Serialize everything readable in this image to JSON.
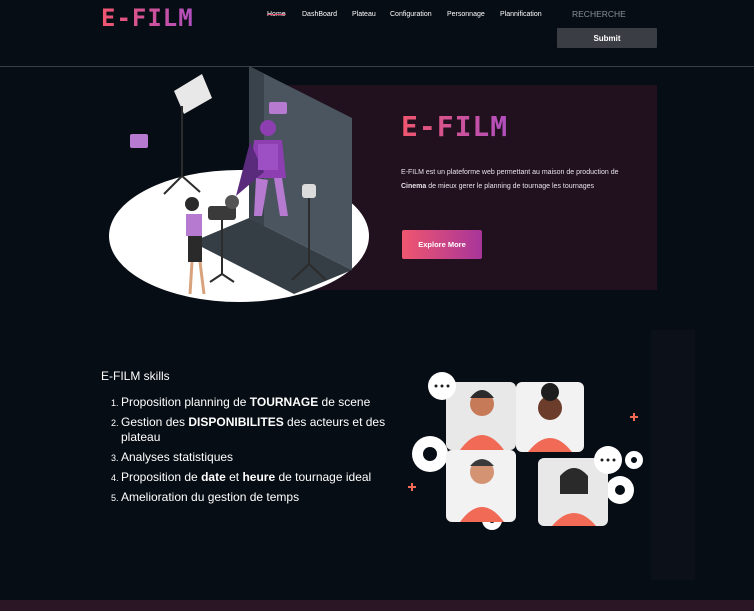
{
  "header": {
    "logo": "E-FILM",
    "nav": [
      "Home",
      "DashBoard",
      "Plateau",
      "Configuration",
      "Personnage",
      "Plannification"
    ],
    "search_placeholder": "RECHERCHE",
    "submit_label": "Submit"
  },
  "hero": {
    "title": "E-FILM",
    "description_parts": [
      "E-FILM est un plateforme web permettant au maison de production de ",
      "Cinema",
      " de mieux gerer le planning de tournage les tournages"
    ],
    "cta_label": "Explore More"
  },
  "skills": {
    "title": "E-FILM skills",
    "items": [
      {
        "parts": [
          "Proposition planning de ",
          "TOURNAGE",
          " de scene"
        ]
      },
      {
        "parts": [
          "Gestion des ",
          "DISPONIBILITES",
          " des acteurs et des plateau"
        ]
      },
      {
        "parts": [
          "Analyses statistiques",
          "",
          ""
        ]
      },
      {
        "parts": [
          "Proposition de ",
          "date",
          " et ",
          "heure",
          " de tournage ideal"
        ]
      },
      {
        "parts": [
          "Amelioration du gestion de temps",
          "",
          ""
        ]
      }
    ]
  },
  "colors": {
    "accent_pink": "#f0566f",
    "accent_purple": "#b04fc0",
    "card_bg": "#21111f",
    "page_bg": "#070d14"
  }
}
